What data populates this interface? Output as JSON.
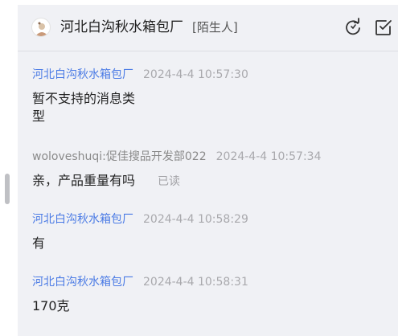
{
  "header": {
    "contact_name": "河北白沟秋水箱包厂",
    "contact_tag": "[陌生人]",
    "icons": [
      "refresh-icon",
      "checkbox-edit-icon"
    ]
  },
  "messages": [
    {
      "sender": "河北白沟秋水箱包厂",
      "time": "2024-4-4 10:57:30",
      "lines": [
        "暂不支持的消息类",
        "型"
      ],
      "status": ""
    },
    {
      "sender": "woloveshuqi:促佳搜品开发部022",
      "time": "2024-4-4 10:57:34",
      "lines": [
        "亲，产品重量有吗"
      ],
      "status": "已读"
    },
    {
      "sender": "河北白沟秋水箱包厂",
      "time": "2024-4-4 10:58:29",
      "lines": [
        "有"
      ],
      "status": ""
    },
    {
      "sender": "河北白沟秋水箱包厂",
      "time": "2024-4-4 10:58:31",
      "lines": [
        "170克"
      ],
      "status": ""
    }
  ],
  "colors": {
    "accent": "#4b7be5",
    "panel_bg": "#f0f1f5"
  }
}
